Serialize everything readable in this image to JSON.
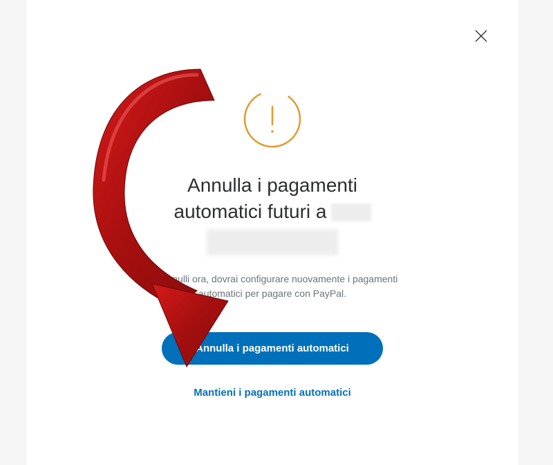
{
  "dialog": {
    "title_line1": "Annulla i pagamenti",
    "title_line2_prefix": "automatici futuri a",
    "description": "Se annulli ora, dovrai configurare nuovamente i pagamenti automatici per pagare con PayPal.",
    "primary_button": "Annulla i pagamenti automatici",
    "secondary_link": "Mantieni i pagamenti automatici"
  },
  "icons": {
    "close": "close-icon",
    "warning": "warning-circle-icon"
  },
  "colors": {
    "primary": "#0070ba",
    "warning_stroke": "#e29a2d",
    "text": "#2c2e2f",
    "muted": "#6c7378"
  }
}
